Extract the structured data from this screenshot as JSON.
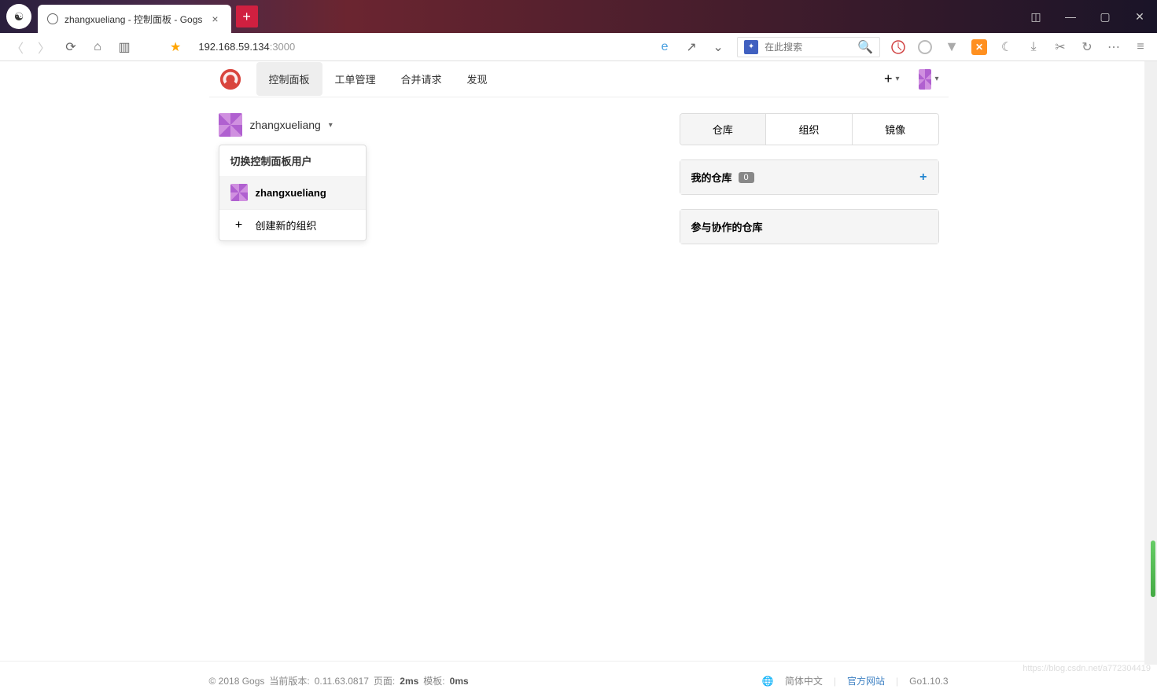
{
  "window": {
    "tab_title": "zhangxueliang - 控制面板 - Gogs",
    "url_host": "192.168.59.134",
    "url_port": ":3000"
  },
  "toolbar": {
    "search_placeholder": "在此搜索"
  },
  "nav": {
    "items": [
      "控制面板",
      "工单管理",
      "合并请求",
      "发现"
    ]
  },
  "user": {
    "name": "zhangxueliang"
  },
  "dropdown": {
    "header": "切换控制面板用户",
    "user_item": "zhangxueliang",
    "create_org": "创建新的组织"
  },
  "sidebar": {
    "tabs": [
      "仓库",
      "组织",
      "镜像"
    ],
    "my_repos": "我的仓库",
    "my_repos_count": "0",
    "collab_repos": "参与协作的仓库"
  },
  "footer": {
    "copyright": "© 2018 Gogs",
    "version_label": "当前版本:",
    "version": "0.11.63.0817",
    "page_label": "页面:",
    "page_time": "2ms",
    "template_label": "模板:",
    "template_time": "0ms",
    "lang": "简体中文",
    "official": "官方网站",
    "go": "Go1.10.3"
  },
  "watermark": "https://blog.csdn.net/a772304419"
}
